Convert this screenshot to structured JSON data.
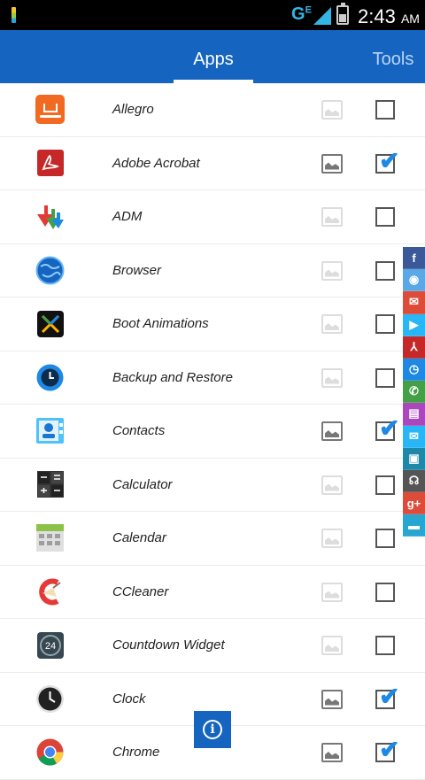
{
  "status_bar": {
    "network": "G",
    "network_sup": "E",
    "time": "2:43",
    "ampm": "AM"
  },
  "tabs": [
    {
      "label": "Apps",
      "active": true
    },
    {
      "label": "Tools",
      "active": false
    }
  ],
  "apps": [
    {
      "name": "Allegro",
      "icon": "allegro-icon",
      "image_on": false,
      "checked": false
    },
    {
      "name": "Adobe Acrobat",
      "icon": "adobe-acrobat-icon",
      "image_on": true,
      "checked": true
    },
    {
      "name": "ADM",
      "icon": "adm-icon",
      "image_on": false,
      "checked": false
    },
    {
      "name": "Browser",
      "icon": "browser-globe-icon",
      "image_on": false,
      "checked": false
    },
    {
      "name": "Boot Animations",
      "icon": "boot-animations-icon",
      "image_on": false,
      "checked": false
    },
    {
      "name": "Backup and Restore",
      "icon": "backup-restore-icon",
      "image_on": false,
      "checked": false
    },
    {
      "name": "Contacts",
      "icon": "contacts-icon",
      "image_on": true,
      "checked": true
    },
    {
      "name": "Calculator",
      "icon": "calculator-icon",
      "image_on": false,
      "checked": false
    },
    {
      "name": "Calendar",
      "icon": "calendar-icon",
      "image_on": false,
      "checked": false
    },
    {
      "name": "CCleaner",
      "icon": "ccleaner-icon",
      "image_on": false,
      "checked": false
    },
    {
      "name": "Countdown Widget",
      "icon": "countdown-widget-icon",
      "image_on": false,
      "checked": false
    },
    {
      "name": "Clock",
      "icon": "clock-icon",
      "image_on": true,
      "checked": true
    },
    {
      "name": "Chrome",
      "icon": "chrome-icon",
      "image_on": true,
      "checked": true
    }
  ],
  "share_strip": [
    {
      "icon": "facebook-icon",
      "glyph": "f",
      "color": "#3b5998"
    },
    {
      "icon": "chrome-small-icon",
      "glyph": "◉",
      "color": "#5aa9e6"
    },
    {
      "icon": "gmail-icon",
      "glyph": "✉",
      "color": "#dd4b39"
    },
    {
      "icon": "play-store-icon",
      "glyph": "▶",
      "color": "#29b6f6"
    },
    {
      "icon": "adobe-small-icon",
      "glyph": "⅄",
      "color": "#c62828"
    },
    {
      "icon": "clock-small-icon",
      "glyph": "◷",
      "color": "#1e88e5"
    },
    {
      "icon": "phone-icon",
      "glyph": "✆",
      "color": "#43a047"
    },
    {
      "icon": "contacts-small-icon",
      "glyph": "▤",
      "color": "#ab47bc"
    },
    {
      "icon": "email-icon",
      "glyph": "✉",
      "color": "#29b6f6"
    },
    {
      "icon": "gallery-icon",
      "glyph": "▣",
      "color": "#1e88a8"
    },
    {
      "icon": "headphones-icon",
      "glyph": "☊",
      "color": "#555555"
    },
    {
      "icon": "google-plus-icon",
      "glyph": "g+",
      "color": "#dd4b39"
    },
    {
      "icon": "message-icon",
      "glyph": "▬",
      "color": "#26a6d1"
    }
  ],
  "info_button": {
    "glyph": "i"
  },
  "checkmark_glyph": "✔"
}
